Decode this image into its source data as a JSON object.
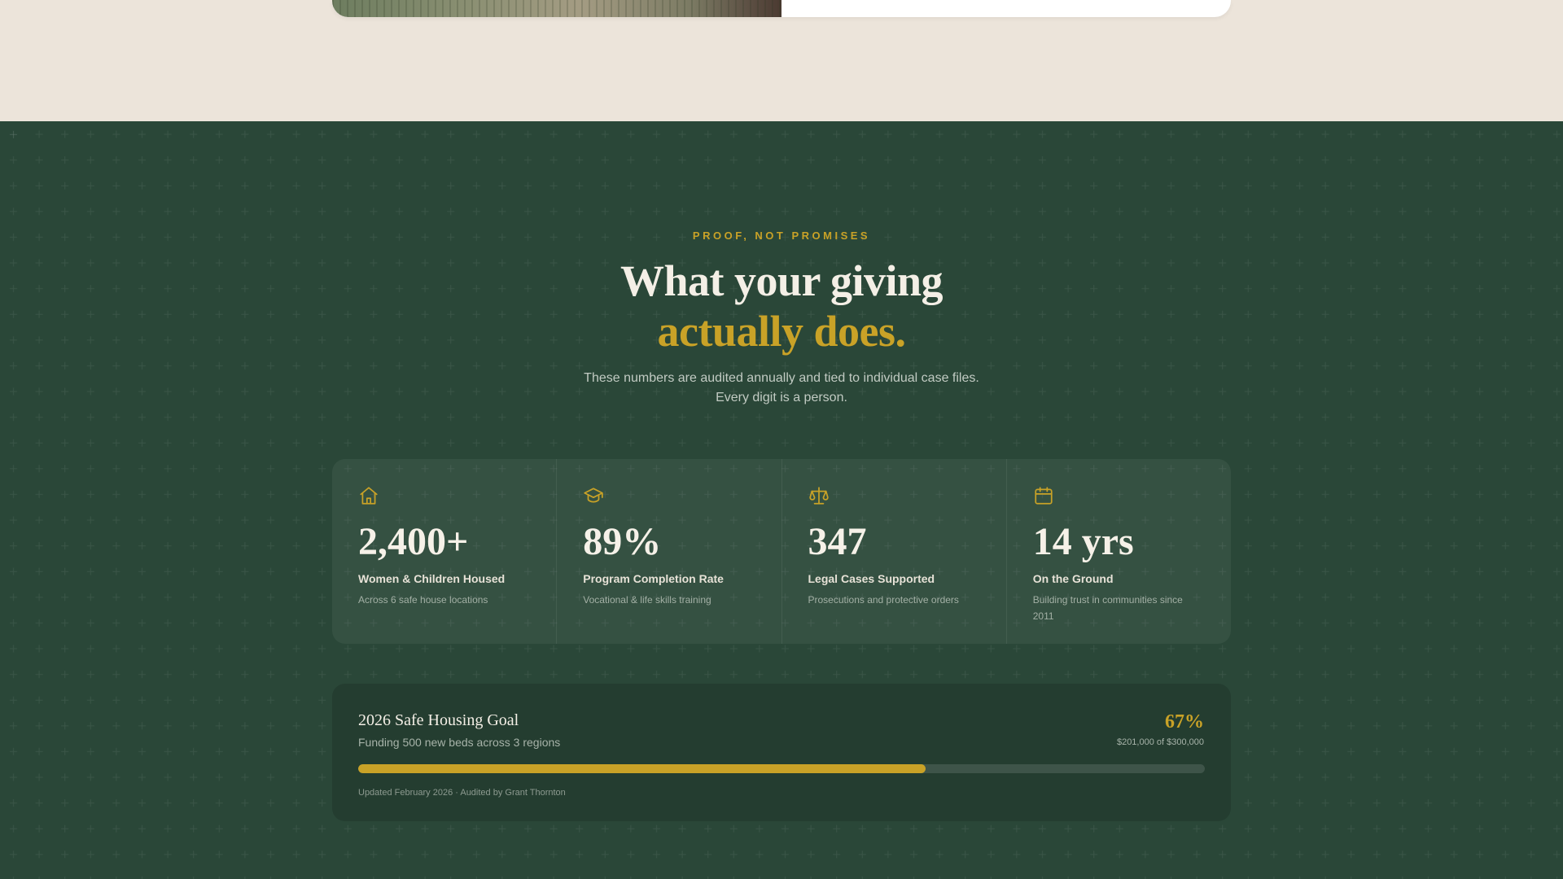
{
  "colors": {
    "background_beige": "#ece4da",
    "section_green": "#2a4738",
    "accent_gold": "#c9a227",
    "text_light": "#f4efe6"
  },
  "section": {
    "eyebrow": "PROOF, NOT PROMISES",
    "headline_line1": "What your giving",
    "headline_line2": "actually does.",
    "subtext_line1": "These numbers are audited annually and tied to individual case files.",
    "subtext_line2": "Every digit is a person."
  },
  "stats": [
    {
      "icon": "home-icon",
      "value": "2,400+",
      "label": "Women & Children Housed",
      "desc": "Across 6 safe house locations"
    },
    {
      "icon": "graduation-cap-icon",
      "value": "89%",
      "label": "Program Completion Rate",
      "desc": "Vocational & life skills training"
    },
    {
      "icon": "scale-icon",
      "value": "347",
      "label": "Legal Cases Supported",
      "desc": "Prosecutions and protective orders"
    },
    {
      "icon": "calendar-icon",
      "value": "14 yrs",
      "label": "On the Ground",
      "desc": "Building trust in communities since 2011"
    }
  ],
  "goal": {
    "title": "2026 Safe Housing Goal",
    "subtitle": "Funding 500 new beds across 3 regions",
    "percent_label": "67%",
    "amount": "$201,000 of $300,000",
    "progress_fraction": 0.67,
    "footer": "Updated February 2026 · Audited by Grant Thornton"
  }
}
